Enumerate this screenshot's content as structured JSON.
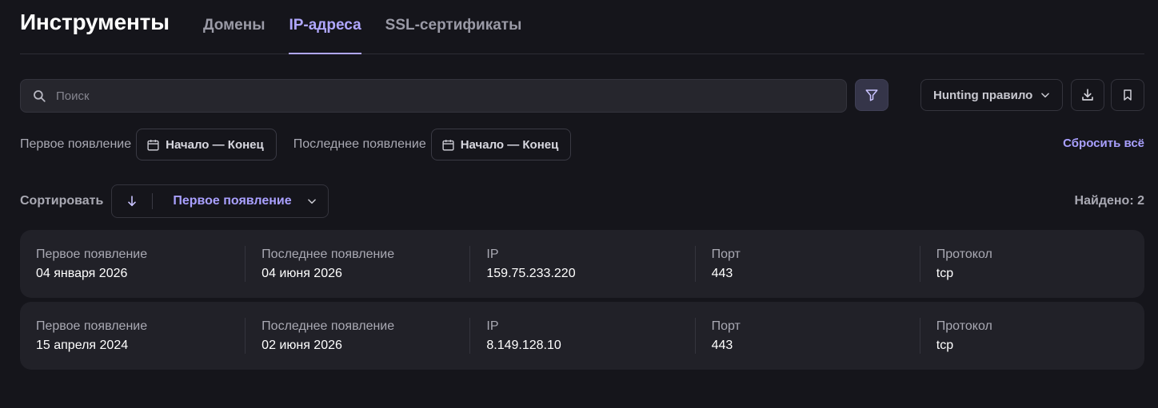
{
  "header": {
    "title": "Инструменты",
    "tabs": [
      {
        "label": "Домены",
        "active": false
      },
      {
        "label": "IP-адреса",
        "active": true
      },
      {
        "label": "SSL-сертификаты",
        "active": false
      }
    ]
  },
  "toolbar": {
    "search_placeholder": "Поиск",
    "search_value": "",
    "hunting_label": "Hunting правило",
    "icons": {
      "search": "search-icon",
      "filter": "filter-icon",
      "hunting_dropdown": "chevron-down-icon",
      "download": "download-icon",
      "bookmark": "bookmark-icon"
    }
  },
  "date_filters": {
    "first_seen_label": "Первое появление",
    "first_seen_range": "Начало — Конец",
    "last_seen_label": "Последнее появление",
    "last_seen_range": "Начало — Конец",
    "reset_label": "Сбросить всё",
    "icons": {
      "calendar": "calendar-icon"
    }
  },
  "sort": {
    "label": "Сортировать",
    "direction_icon": "arrow-down-icon",
    "field": "Первое появление",
    "found": "Найдено: 2"
  },
  "results": {
    "rows": [
      {
        "first_seen_label": "Первое появление",
        "first_seen": "04 января 2026",
        "last_seen_label": "Последнее появление",
        "last_seen": "04 июня 2026",
        "ip_label": "IP",
        "ip": "159.75.233.220",
        "port_label": "Порт",
        "port": "443",
        "protocol_label": "Протокол",
        "protocol": "tcp"
      },
      {
        "first_seen_label": "Первое появление",
        "first_seen": "15 апреля 2024",
        "last_seen_label": "Последнее появление",
        "last_seen": "02 июня 2026",
        "ip_label": "IP",
        "ip": "8.149.128.10",
        "port_label": "Порт",
        "port": "443",
        "protocol_label": "Протокол",
        "protocol": "tcp"
      }
    ]
  },
  "colors": {
    "background": "#15151b",
    "accent": "#b0a7ff",
    "row_background": "#212128"
  }
}
